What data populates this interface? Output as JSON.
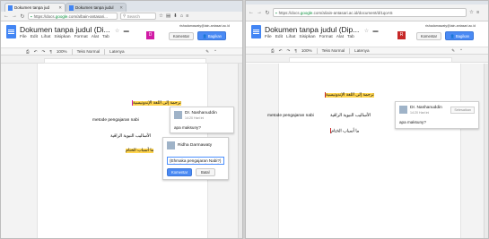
{
  "left": {
    "tabs": [
      {
        "label": "Dokumen tanpa jud",
        "active": true
      },
      {
        "label": "Dokumen tanpa judul",
        "active": false
      }
    ],
    "url_prefix": "https://docs.",
    "url_host": "google",
    "url_rest": ".com/a/bain-antasari...",
    "search_placeholder": "Search",
    "doc_title": "Dokumen tanpa judul (Di...",
    "menu": [
      "File",
      "Edit",
      "Lihat",
      "Sisipkan",
      "Format",
      "Alat",
      "Tab"
    ],
    "email": "rishadamawaty@iain-antasari.ac.id",
    "collab_initial": "D",
    "comments_label": "Komentar",
    "share_label": "Bagikan",
    "toolbar": {
      "zoom": "100%",
      "style": "Teks Normal",
      "font": "Latenya"
    },
    "doc_lines": {
      "arabic_1": "ترجمة إلى اللغة الإندونيسية",
      "latin_1": "metode pengajaran nabi",
      "arabic_2": "الأساليب النبوية الراقية",
      "arabic_3": "ما أسباب الختام"
    },
    "comment_1": {
      "name": "Dr. Nashanuddin",
      "time": "14:20 Hari ini",
      "text": "apa maksuny?"
    },
    "comment_2": {
      "name": "Ridha Darmawaty",
      "reply_value": "(Ehmaka pengajaran Nabi?)",
      "primary_label": "Komentar",
      "cancel_label": "Batal"
    }
  },
  "right": {
    "url_prefix": "https://docs.",
    "url_host": "google",
    "url_rest": ".com/a/iain-antasari.ac.id/document/d/1qoA5",
    "doc_title": "Dokumen tanpa judul (Dip...",
    "menu": [
      "File",
      "Edit",
      "Lihat",
      "Sisipkan",
      "Format",
      "Alat",
      "Tab"
    ],
    "email": "rishadamawaty@iain-antasari.ac.id",
    "collab_initial": "R",
    "comments_label": "Komentar",
    "share_label": "Bagikan",
    "toolbar": {
      "zoom": "100%",
      "style": "Teks Normal",
      "font": "Latenya"
    },
    "doc_lines": {
      "arabic_1": "ترجمة إلى اللغة الإندونيسية",
      "latin_1": "metode pengajaran nabi",
      "arabic_2": "الأساليب النبوية الراقية",
      "arabic_3": "ما أسباب الختام"
    },
    "comment_1": {
      "name": "Dr. Nashanuddin",
      "time": "14:20 Hari ini",
      "resolve_label": "Selesaikan",
      "text": "apa maksuny?"
    }
  },
  "colors": {
    "accent": "#4a8af4",
    "highlight": "#ffd54f",
    "collaborator": "#d11aa5"
  },
  "icons": [
    "back-icon",
    "forward-icon",
    "reload-icon",
    "lock-icon",
    "star-icon",
    "download-icon",
    "menu-icon",
    "folder-icon",
    "print-icon",
    "undo-icon",
    "redo-icon",
    "paint-format-icon",
    "pencil-icon",
    "collapse-icon"
  ]
}
